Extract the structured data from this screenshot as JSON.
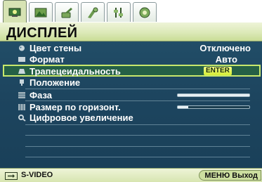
{
  "tabs": [
    {
      "icon": "display-icon",
      "active": true
    },
    {
      "icon": "picture-icon",
      "active": false
    },
    {
      "icon": "settings-icon",
      "active": false
    },
    {
      "icon": "advanced-settings-icon",
      "active": false
    },
    {
      "icon": "sliders-icon",
      "active": false
    },
    {
      "icon": "info-icon",
      "active": false
    }
  ],
  "header": {
    "title": "ДИСПЛЕЙ"
  },
  "menu": {
    "items": [
      {
        "label": "Цвет стены",
        "value": "Отключено",
        "icon": "wall-color-icon"
      },
      {
        "label": "Формат",
        "value": "Авто",
        "icon": "aspect-ratio-icon"
      },
      {
        "label": "Трапецеидальность",
        "value": "ENTER",
        "icon": "keystone-icon",
        "selected": true
      },
      {
        "label": "Положение",
        "value": "",
        "icon": "position-icon"
      },
      {
        "label": "Фаза",
        "value": "",
        "icon": "phase-icon",
        "slider_level": 1.0
      },
      {
        "label": "Размер по горизонт.",
        "value": "",
        "icon": "h-size-icon",
        "slider_level": 0.15
      },
      {
        "label": "Цифровое увеличение",
        "value": "",
        "icon": "digital-zoom-icon"
      }
    ]
  },
  "footer": {
    "source": "S-VIDEO",
    "menu_exit": "МЕНЮ Выход"
  },
  "colors": {
    "panel": "#1f4963",
    "header": "#dce9b8",
    "selected_border": "#c8e86c",
    "enter_badge": "#e4f450"
  }
}
